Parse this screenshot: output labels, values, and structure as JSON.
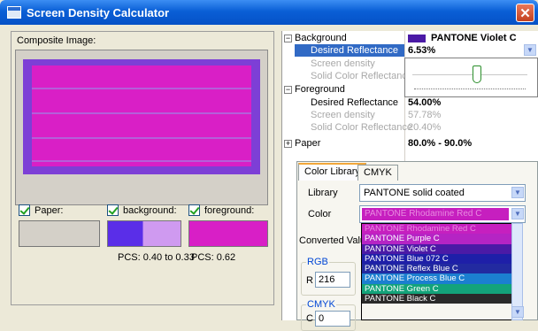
{
  "window": {
    "title": "Screen Density Calculator"
  },
  "left": {
    "composite_label": "Composite Image:",
    "checkboxes": [
      {
        "label": "Paper:"
      },
      {
        "label": "background:"
      },
      {
        "label": "foreground:"
      }
    ],
    "pcs_bg": "PCS: 0.40 to 0.33",
    "pcs_fg": "PCS: 0.62"
  },
  "grid": {
    "background": {
      "label": "Background",
      "value": "PANTONE Violet C"
    },
    "bg_desired": {
      "label": "Desired Reflectance",
      "value": "6.53%"
    },
    "bg_density": {
      "label": "Screen density"
    },
    "bg_solid": {
      "label": "Solid Color Reflectance"
    },
    "foreground": {
      "label": "Foreground"
    },
    "fg_desired": {
      "label": "Desired Reflectance",
      "value": "54.00%"
    },
    "fg_density": {
      "label": "Screen density",
      "value": "57.78%"
    },
    "fg_solid": {
      "label": "Solid Color Reflectance",
      "value": "20.40%"
    },
    "paper": {
      "label": "Paper",
      "value": "80.0% - 90.0%"
    }
  },
  "tabs": [
    "Color Library",
    "CMYK"
  ],
  "library": {
    "label": "Library",
    "value": "PANTONE solid coated"
  },
  "color": {
    "label": "Color",
    "value": "PANTONE Rhodamine Red C"
  },
  "converted": {
    "label": "Converted Valu",
    "rgb_label": "RGB",
    "r_label": "R",
    "r_value": "216",
    "cmyk_label": "CMYK",
    "c_label": "C",
    "c_value": "0"
  },
  "dropdown_items": [
    {
      "label": "PANTONE Rhodamine Red C",
      "color": "#c61fbf"
    },
    {
      "label": "PANTONE Purple C",
      "color": "#b524c4"
    },
    {
      "label": "PANTONE Violet C",
      "color": "#4b1aa6"
    },
    {
      "label": "PANTONE Blue 072 C",
      "color": "#1e1fa8"
    },
    {
      "label": "PANTONE Reflex Blue C",
      "color": "#222aa0"
    },
    {
      "label": "PANTONE Process Blue C",
      "color": "#1b7fd0"
    },
    {
      "label": "PANTONE Green C",
      "color": "#13a37a"
    },
    {
      "label": "PANTONE Black C",
      "color": "#2a2a2a"
    }
  ],
  "colors": {
    "paper": "#d4d0c8",
    "background": "#5a2ee8",
    "background_light": "#cf9af0",
    "foreground": "#d81fc6",
    "selection": "#316ac5"
  }
}
